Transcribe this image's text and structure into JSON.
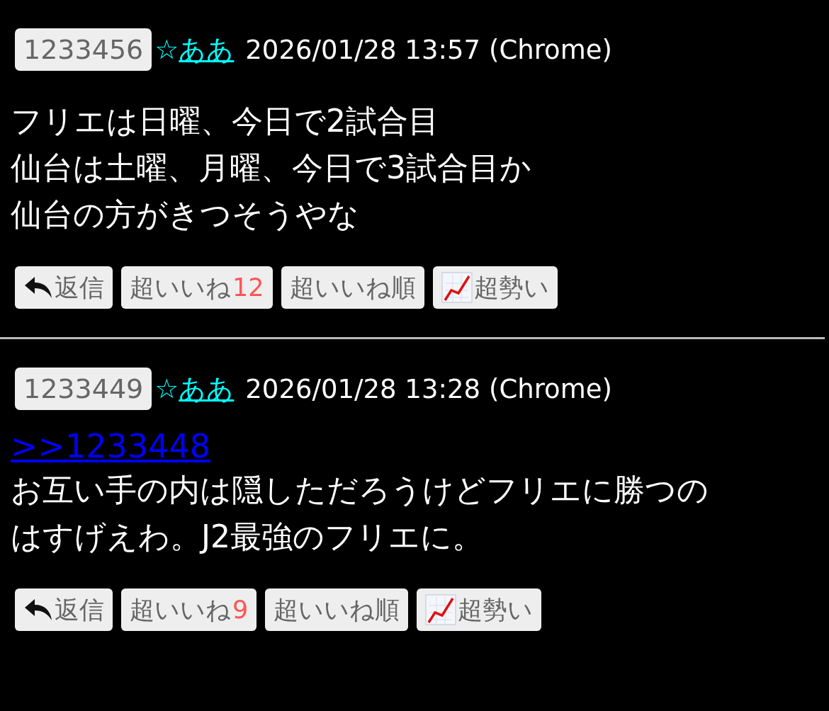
{
  "posts": [
    {
      "number": "1233456",
      "star": "☆",
      "name": "ああ",
      "date": "2026/01/28 13:57",
      "agent": "(Chrome)",
      "lines": [
        "フリエは日曜、今日で2試合目",
        "仙台は土曜、月曜、今日で3試合目か",
        "仙台の方がきつそうやな"
      ],
      "buttons": [
        {
          "kind": "reply",
          "label": "返信"
        },
        {
          "kind": "like",
          "label": "超いいね",
          "count": "12"
        },
        {
          "kind": "sort",
          "label": "超いいね順"
        },
        {
          "kind": "trend",
          "label": "超勢い"
        }
      ]
    },
    {
      "number": "1233449",
      "star": "☆",
      "name": "ああ",
      "date": "2026/01/28 13:28",
      "agent": "(Chrome)",
      "anchor": ">>1233448",
      "lines": [
        "お互い手の内は隠しただろうけどフリエに勝つのはすげえわ。J2最強のフリエに。"
      ],
      "buttons": [
        {
          "kind": "reply",
          "label": "返信"
        },
        {
          "kind": "like",
          "label": "超いいね",
          "count": "9"
        },
        {
          "kind": "sort",
          "label": "超いいね順"
        },
        {
          "kind": "trend",
          "label": "超勢い"
        }
      ]
    }
  ]
}
